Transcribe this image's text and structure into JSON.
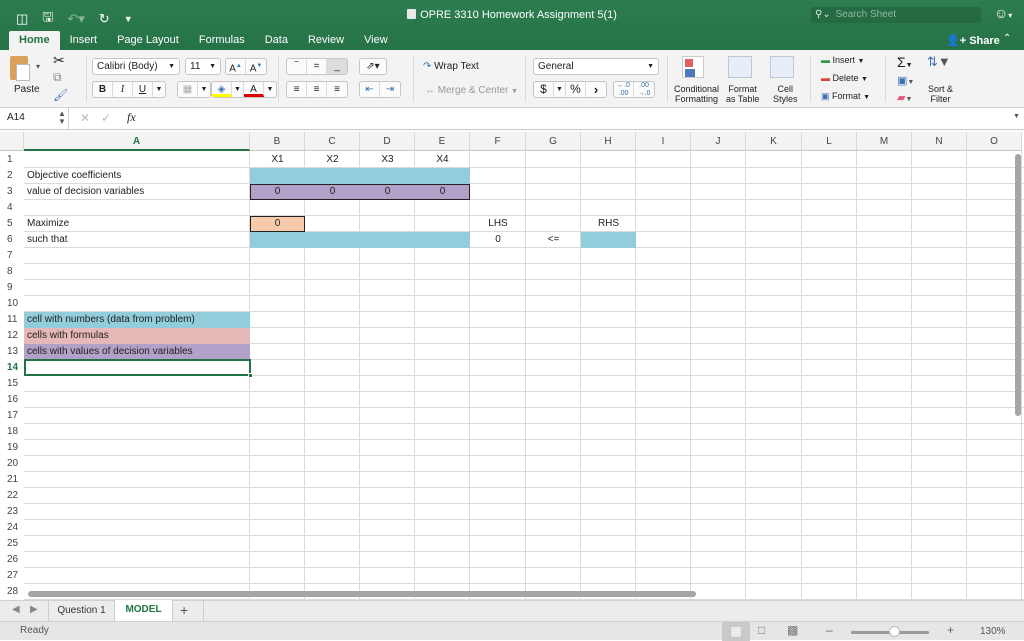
{
  "titlebar": {
    "document_title": "OPRE 3310 Homework Assignment 5(1)",
    "search_placeholder": "Search Sheet",
    "share_label": "Share"
  },
  "ribbon_tabs": [
    {
      "label": "Home",
      "active": true
    },
    {
      "label": "Insert"
    },
    {
      "label": "Page Layout"
    },
    {
      "label": "Formulas"
    },
    {
      "label": "Data"
    },
    {
      "label": "Review"
    },
    {
      "label": "View"
    }
  ],
  "ribbon": {
    "paste_label": "Paste",
    "font_name": "Calibri (Body)",
    "font_size": "11",
    "bold": "B",
    "italic": "I",
    "underline": "U",
    "wrap_text": "Wrap Text",
    "merge_center": "Merge & Center",
    "number_format": "General",
    "currency": "$",
    "percent": "%",
    "comma": "›",
    "conditional_formatting": [
      "Conditional",
      "Formatting"
    ],
    "format_as_table": [
      "Format",
      "as Table"
    ],
    "cell_styles": [
      "Cell",
      "Styles"
    ],
    "insert": "Insert",
    "delete": "Delete",
    "format": "Format",
    "sort_filter": [
      "Sort &",
      "Filter"
    ],
    "autosum": "Σ"
  },
  "formula_bar": {
    "name_box": "A14",
    "fx": "fx",
    "value": ""
  },
  "columns": [
    "A",
    "B",
    "C",
    "D",
    "E",
    "F",
    "G",
    "H",
    "I",
    "J",
    "K",
    "L",
    "M",
    "N",
    "O"
  ],
  "selected_column": "A",
  "rows": [
    1,
    2,
    3,
    4,
    5,
    6,
    7,
    8,
    9,
    10,
    11,
    12,
    13,
    14,
    15,
    16,
    17,
    18,
    19,
    20,
    21,
    22,
    23,
    24,
    25,
    26,
    27,
    28
  ],
  "selected_row": 14,
  "cells": {
    "B1": "X1",
    "C1": "X2",
    "D1": "X3",
    "E1": "X4",
    "A2": "Objective coefficients",
    "A3": "value of decision variables",
    "B3": "0",
    "C3": "0",
    "D3": "0",
    "E3": "0",
    "A5": "Maximize",
    "B5": "0",
    "F5": "LHS",
    "H5": "RHS",
    "A6": "such that",
    "F6": "0",
    "G6": "<=",
    "A11": "cell with numbers (data from problem)",
    "A12": "cells with formulas",
    "A13": "cells with values of decision variables"
  },
  "colors": {
    "data_fill": "#92cddc",
    "formula_fill": "#f8cbad",
    "legend_formula_fill": "#e6b8b7",
    "decision_fill": "#b1a0c7",
    "accent": "#217346"
  },
  "sheet_tabs": [
    {
      "label": "Question 1"
    },
    {
      "label": "MODEL",
      "active": true
    }
  ],
  "status": {
    "state": "Ready",
    "zoom": "130%",
    "zoom_level": 1.3
  }
}
